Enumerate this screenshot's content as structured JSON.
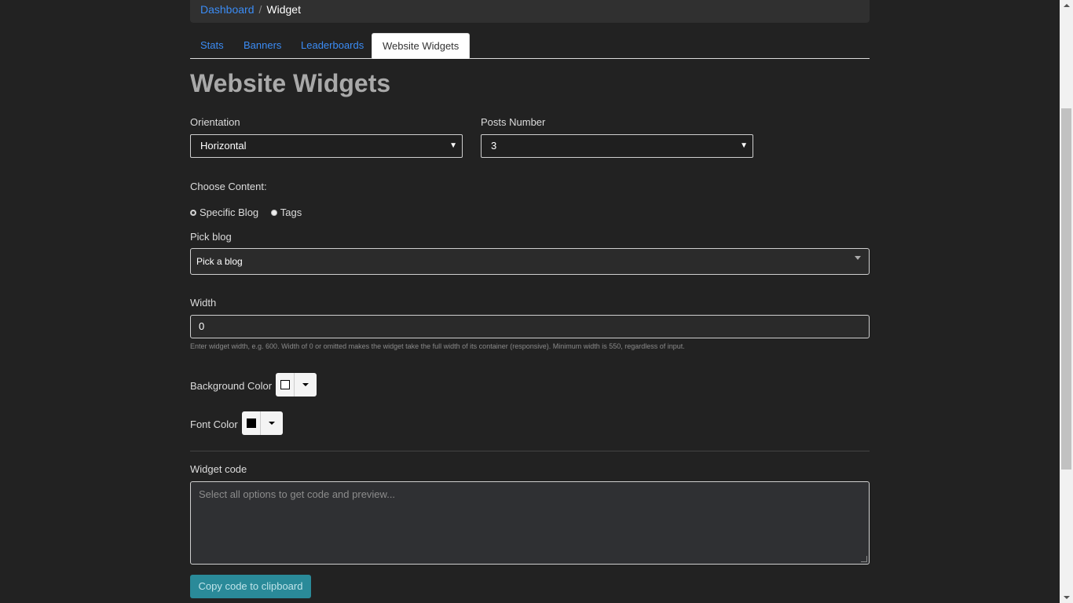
{
  "breadcrumb": {
    "parent": "Dashboard",
    "separator": "/",
    "current": "Widget"
  },
  "tabs": [
    {
      "label": "Stats",
      "active": false
    },
    {
      "label": "Banners",
      "active": false
    },
    {
      "label": "Leaderboards",
      "active": false
    },
    {
      "label": "Website Widgets",
      "active": true
    }
  ],
  "page": {
    "title": "Website Widgets"
  },
  "orientation": {
    "label": "Orientation",
    "value": "Horizontal"
  },
  "posts_number": {
    "label": "Posts Number",
    "value": "3"
  },
  "content": {
    "label": "Choose Content:",
    "options": [
      {
        "label": "Specific Blog",
        "checked": true
      },
      {
        "label": "Tags",
        "checked": false
      }
    ]
  },
  "pick_blog": {
    "label": "Pick blog",
    "value": "Pick a blog"
  },
  "width": {
    "label": "Width",
    "value": "0",
    "help": "Enter widget width, e.g. 600. Width of 0 or omitted makes the widget take the full width of its container (responsive). Minimum width is 550, regardless of input."
  },
  "background_color": {
    "label": "Background Color",
    "swatch": "#ffffff"
  },
  "font_color": {
    "label": "Font Color",
    "swatch": "#000000"
  },
  "widget_code": {
    "label": "Widget code",
    "placeholder": "Select all options to get code and preview..."
  },
  "copy_button": {
    "label": "Copy code to clipboard"
  },
  "colors": {
    "link": "#3b8cf5",
    "background": "#222222",
    "button": "#2a8a99"
  }
}
